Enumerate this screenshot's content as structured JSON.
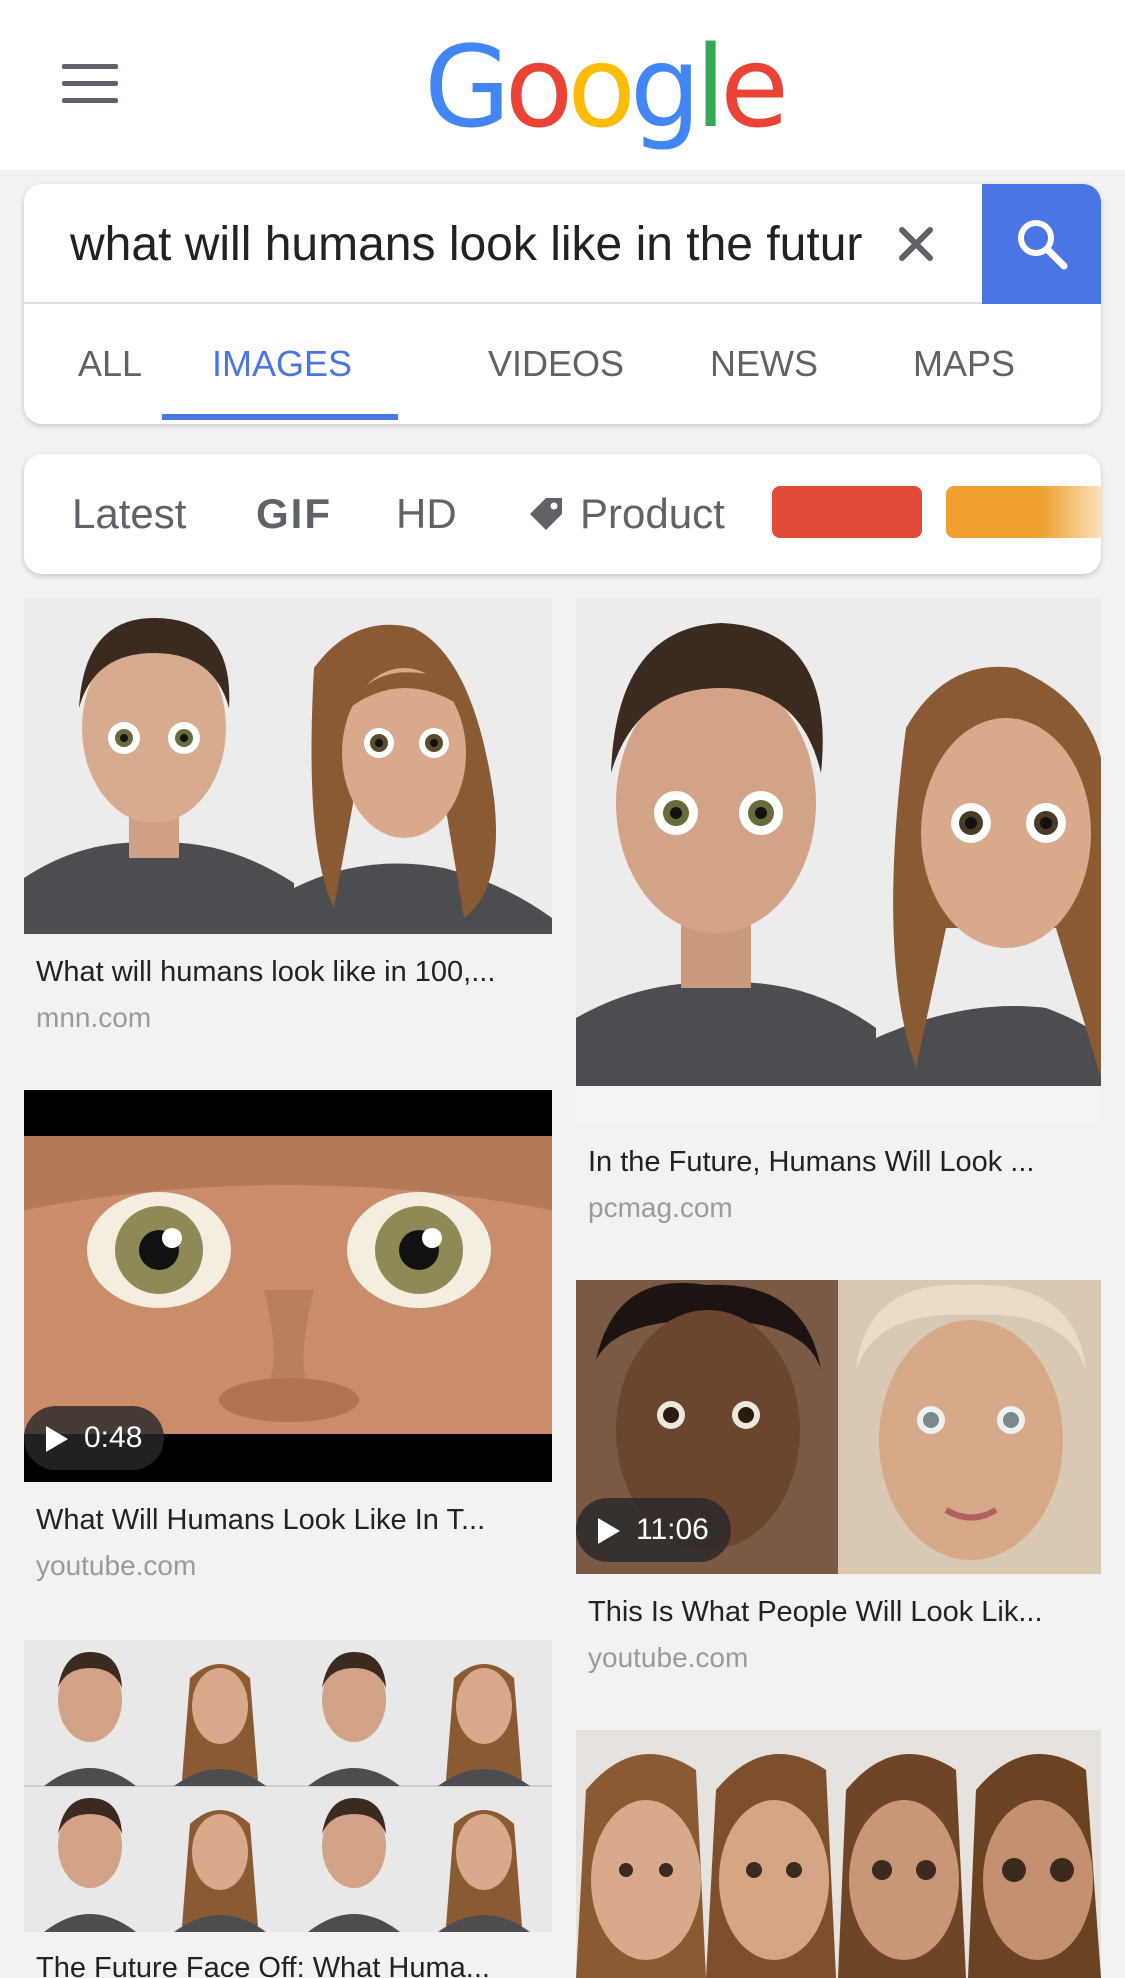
{
  "app": {
    "logo_text": "Google"
  },
  "search": {
    "query": "what will humans look like in the futur",
    "clear_icon": "close-icon",
    "submit_icon": "search-icon"
  },
  "tabs": [
    {
      "label": "ALL",
      "active": false
    },
    {
      "label": "IMAGES",
      "active": true
    },
    {
      "label": "VIDEOS",
      "active": false
    },
    {
      "label": "NEWS",
      "active": false
    },
    {
      "label": "MAPS",
      "active": false
    }
  ],
  "chips": [
    {
      "label": "Latest"
    },
    {
      "label": "GIF"
    },
    {
      "label": "HD"
    },
    {
      "label": "Product",
      "icon": "tag-icon"
    }
  ],
  "color_filters": [
    "#e24a3b",
    "#f0a030"
  ],
  "results": [
    {
      "caption": "What will humans look like in 100,...",
      "domain": "mnn.com"
    },
    {
      "caption": "In the Future, Humans Will Look ...",
      "domain": "pcmag.com"
    },
    {
      "caption": "What Will Humans Look Like In T...",
      "domain": "youtube.com",
      "duration": "0:48"
    },
    {
      "caption": "This Is What People Will Look Lik...",
      "domain": "youtube.com",
      "duration": "11:06"
    },
    {
      "caption": "The Future Face Off: What Huma...",
      "domain": ""
    }
  ],
  "colors": {
    "accent": "#4a76e5",
    "muted": "#5f6368"
  }
}
